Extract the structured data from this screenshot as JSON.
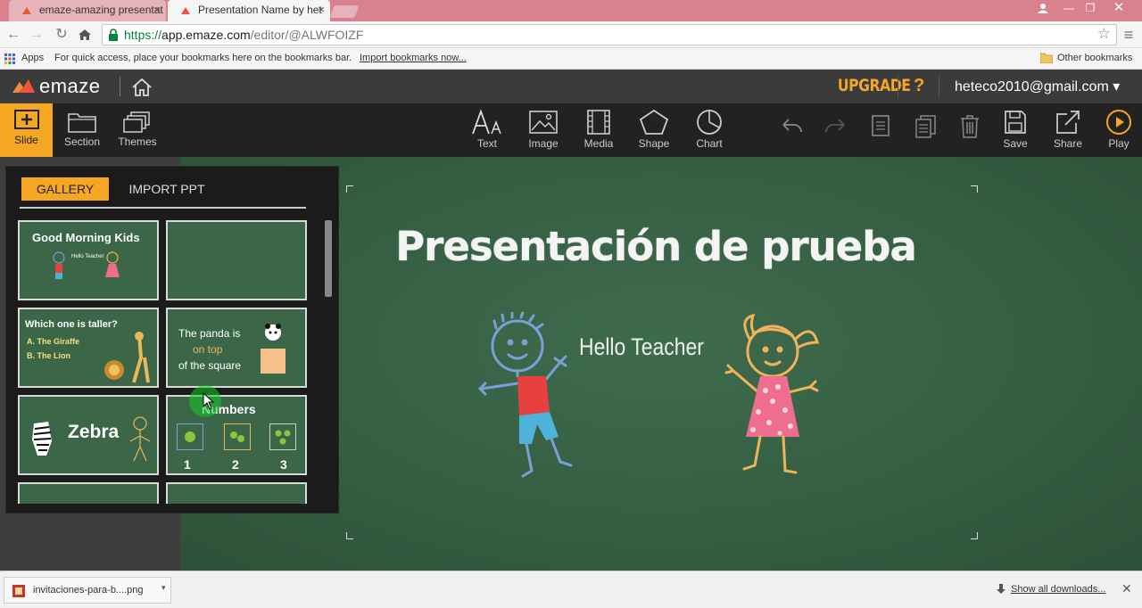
{
  "browser": {
    "tabs": [
      {
        "title": "emaze-amazing presentat",
        "active": false
      },
      {
        "title": "Presentation Name by het",
        "active": true
      }
    ],
    "url_scheme": "https://",
    "url_host": "app.emaze.com",
    "url_path": "/editor/@ALWFOIZF",
    "bookmarks": {
      "apps_label": "Apps",
      "hint_text": "For quick access, place your bookmarks here on the bookmarks bar.",
      "import_link": "Import bookmarks now...",
      "other_label": "Other bookmarks"
    }
  },
  "header": {
    "logo_text": "emaze",
    "upgrade_label": "UPGRADE",
    "help_label": "?",
    "user_email": "heteco2010@gmail.com",
    "user_caret": "▾"
  },
  "toolbar": {
    "left": [
      {
        "label": "Slide",
        "icon": "plus-box-icon"
      },
      {
        "label": "Section",
        "icon": "folder-icon"
      },
      {
        "label": "Themes",
        "icon": "stacked-windows-icon"
      }
    ],
    "insert": [
      {
        "label": "Text",
        "icon": "text-icon"
      },
      {
        "label": "Image",
        "icon": "image-icon"
      },
      {
        "label": "Media",
        "icon": "film-icon"
      },
      {
        "label": "Shape",
        "icon": "pentagon-icon"
      },
      {
        "label": "Chart",
        "icon": "pie-chart-icon"
      }
    ],
    "actions": [
      {
        "label": "Save",
        "icon": "floppy-icon"
      },
      {
        "label": "Share",
        "icon": "share-icon"
      },
      {
        "label": "Play",
        "icon": "play-icon"
      }
    ],
    "accent_color": "#f5a623"
  },
  "panel": {
    "tabs": [
      "GALLERY",
      "IMPORT PPT"
    ],
    "active_tab": "GALLERY",
    "thumbs": [
      {
        "title": "Good Morning Kids",
        "sub": "Hello Teacher"
      },
      {
        "title": "",
        "sub": ""
      },
      {
        "title": "Which one is taller?",
        "options": [
          "A. The Giraffe",
          "B. The Lion"
        ]
      },
      {
        "title": "The panda is",
        "mid": "on top",
        "end": "of the square"
      },
      {
        "title": "Zebra"
      },
      {
        "title": "Numbers",
        "digits": [
          "1",
          "2",
          "3"
        ]
      }
    ]
  },
  "slide": {
    "title": "Presentación de prueba",
    "greeting": "Hello Teacher"
  },
  "download": {
    "file_name": "invitaciones-para-b....png",
    "show_all": "Show all downloads..."
  }
}
